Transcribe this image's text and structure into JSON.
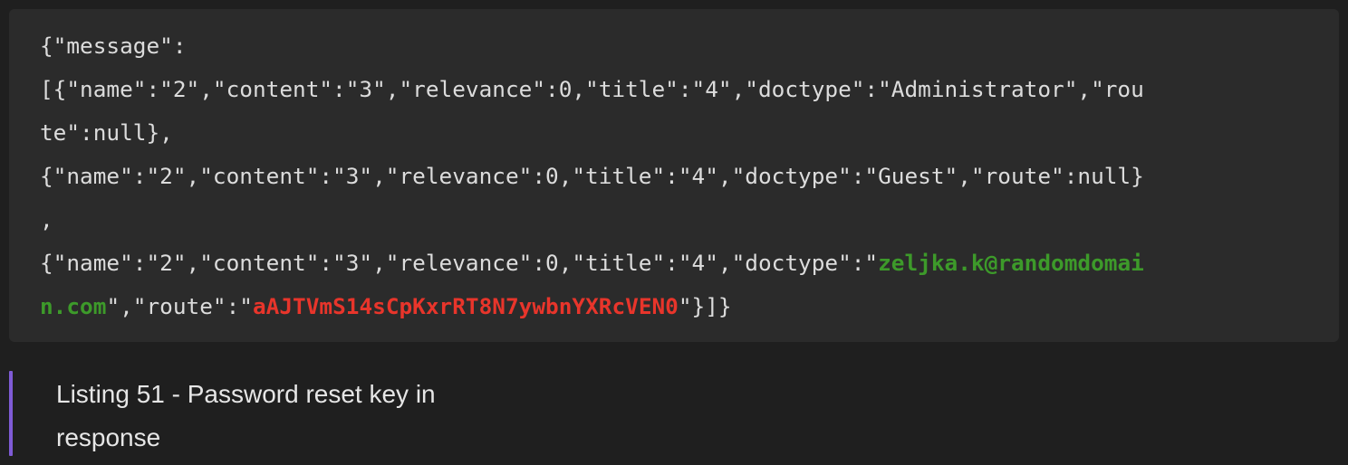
{
  "code": {
    "lines": [
      "{\"message\":",
      "[{\"name\":\"2\",\"content\":\"3\",\"relevance\":0,\"title\":\"4\",\"doctype\":\"Administrator\",\"rou",
      "te\":null},",
      "{\"name\":\"2\",\"content\":\"3\",\"relevance\":0,\"title\":\"4\",\"doctype\":\"Guest\",\"route\":null}",
      ","
    ],
    "line6_prefix": "{\"name\":\"2\",\"content\":\"3\",\"relevance\":0,\"title\":\"4\",\"doctype\":\"",
    "email_part1": "zeljka.k@randomdomai",
    "email_part2": "n.com",
    "line7_mid": "\",\"route\":\"",
    "reset_key": "aAJTVmS14sCpKxrRT8N7ywbnYXRcVEN0",
    "line7_suffix": "\"}]}"
  },
  "caption": {
    "line1": "Listing 51 - Password reset key in",
    "line2": "response"
  },
  "colors": {
    "email": "#3d9a2a",
    "reset_key": "#e8352b",
    "caption_bar": "#7f5bd6"
  }
}
